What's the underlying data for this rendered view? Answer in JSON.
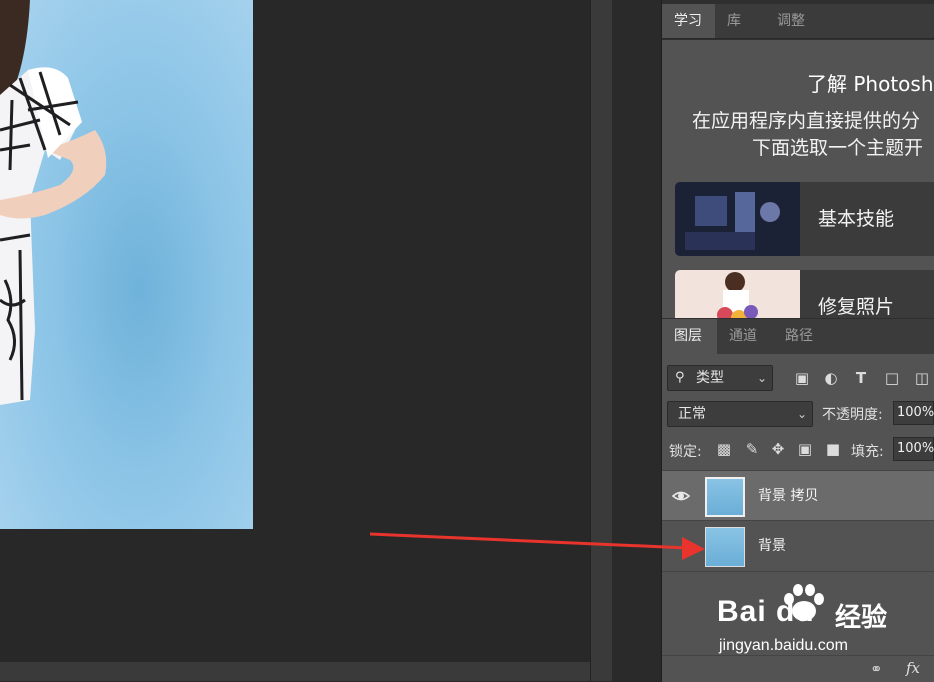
{
  "learn_tabs": [
    {
      "label": "学习",
      "active": true
    },
    {
      "label": "库",
      "active": false
    },
    {
      "label": "调整",
      "active": false
    }
  ],
  "learn_panel": {
    "title": "了解 Photosh",
    "desc_line1": "在应用程序内直接提供的分",
    "desc_line2": "下面选取一个主题开",
    "topics": [
      {
        "label": "基本技能",
        "thumb_icon": "bedroom-photo-thumbnail"
      },
      {
        "label": "修复照片",
        "thumb_icon": "flowers-photo-thumbnail"
      }
    ]
  },
  "layers_tabs": [
    {
      "label": "图层",
      "active": true
    },
    {
      "label": "通道",
      "active": false
    },
    {
      "label": "路径",
      "active": false
    }
  ],
  "layers_panel": {
    "filter_label": "类型",
    "blend_mode": "正常",
    "opacity_label": "不透明度:",
    "opacity_value": "100%",
    "lock_label": "锁定:",
    "fill_label": "填充:",
    "fill_value": "100%",
    "layers": [
      {
        "name": "背景 拷贝",
        "visible": true,
        "selected": true
      },
      {
        "name": "背景",
        "visible": false,
        "selected": false
      }
    ],
    "footer_link_icon": "link-icon",
    "footer_fx": "fx"
  },
  "annotation": {
    "arrow_color": "#e8342c"
  },
  "watermark": {
    "brand": "Bai du",
    "brand_cn": "经验",
    "url": "jingyan.baidu.com"
  }
}
